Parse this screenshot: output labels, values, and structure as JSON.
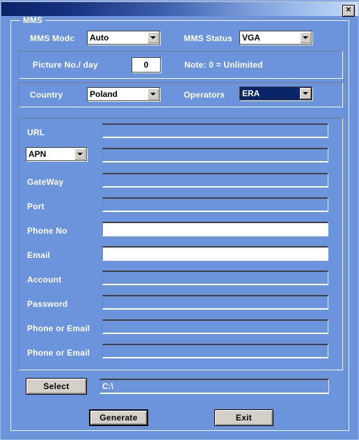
{
  "window": {
    "title": "",
    "close_label": "✕",
    "close_icon": "close-icon",
    "bg_color": "#6B94DC",
    "titlebar_start_color": "#0A246A",
    "titlebar_end_color": "#CFE2FB"
  },
  "groupbox": {
    "title": "MMS"
  },
  "top_row": {
    "mms_mode": {
      "label": "MMS Modc",
      "value": "Auto"
    },
    "mms_status": {
      "label": "MMS Status",
      "value": "VGA"
    }
  },
  "picture_row": {
    "label": "Picture No./ day",
    "value": "0",
    "note": "Note: 0 = Unlimited"
  },
  "country_row": {
    "country": {
      "label": "Country",
      "value": "Poland"
    },
    "operators": {
      "label": "Operators",
      "value": "ERA",
      "selected_bg": "#0A246A"
    }
  },
  "fields": [
    {
      "label": "URL",
      "value": "",
      "enabled": false,
      "type": "text"
    },
    {
      "label": "APN",
      "value": "",
      "enabled": false,
      "type": "combo"
    },
    {
      "label": "GateWay",
      "value": "",
      "enabled": false,
      "type": "text"
    },
    {
      "label": "Port",
      "value": "",
      "enabled": false,
      "type": "text"
    },
    {
      "label": "Phone No",
      "value": "",
      "enabled": true,
      "type": "text"
    },
    {
      "label": "Email",
      "value": "",
      "enabled": true,
      "type": "text"
    },
    {
      "label": "Account",
      "value": "",
      "enabled": false,
      "type": "text"
    },
    {
      "label": "Password",
      "value": "",
      "enabled": false,
      "type": "text"
    },
    {
      "label": "Phone or Email",
      "value": "",
      "enabled": false,
      "type": "text"
    },
    {
      "label": "Phone or Email",
      "value": "",
      "enabled": false,
      "type": "text"
    }
  ],
  "path_row": {
    "select_label": "Select",
    "path_value": "C:\\"
  },
  "actions": {
    "generate_label": "Generate",
    "exit_label": "Exit"
  }
}
